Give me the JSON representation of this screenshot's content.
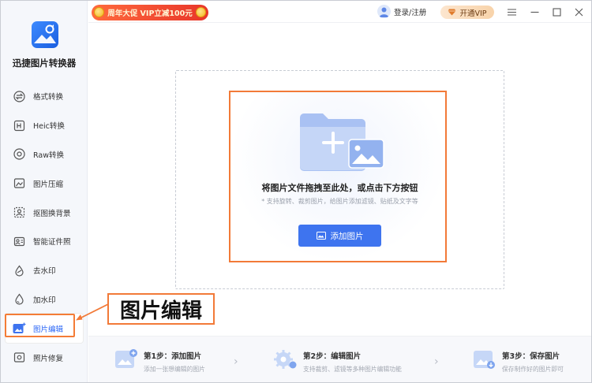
{
  "app": {
    "name": "迅捷图片转换器"
  },
  "titlebar": {
    "promo_text": "周年大促 VIP立减100元",
    "login_label": "登录/注册",
    "vip_label": "开通VIP",
    "menu_icon": "menu-icon",
    "minimize_icon": "minimize-icon",
    "maximize_icon": "maximize-icon",
    "close_icon": "close-icon"
  },
  "sidebar": {
    "items": [
      {
        "label": "格式转换",
        "icon": "format-convert-icon"
      },
      {
        "label": "Heic转换",
        "icon": "heic-icon"
      },
      {
        "label": "Raw转换",
        "icon": "raw-icon"
      },
      {
        "label": "图片压缩",
        "icon": "compress-icon"
      },
      {
        "label": "抠图换背景",
        "icon": "cutout-icon"
      },
      {
        "label": "智能证件照",
        "icon": "id-photo-icon"
      },
      {
        "label": "去水印",
        "icon": "remove-watermark-icon"
      },
      {
        "label": "加水印",
        "icon": "add-watermark-icon"
      },
      {
        "label": "图片编辑",
        "icon": "image-edit-icon",
        "active": true
      },
      {
        "label": "照片修复",
        "icon": "photo-repair-icon"
      }
    ]
  },
  "main": {
    "drop_title": "将图片文件拖拽至此处，或点击下方按钮",
    "drop_hint": "* 支持旋转、裁剪图片，给图片添加滤镜、贴纸及文字等",
    "add_button_label": "添加图片"
  },
  "steps": [
    {
      "title": "第1步：添加图片",
      "desc": "添加一张想编辑的图片"
    },
    {
      "title": "第2步：编辑图片",
      "desc": "支持裁剪、滤镜等多种图片编辑功能"
    },
    {
      "title": "第3步：保存图片",
      "desc": "保存制作好的图片即可"
    }
  ],
  "annotation": {
    "callout_text": "图片编辑"
  },
  "colors": {
    "accent": "#3e74ef",
    "highlight": "#f27a38",
    "promo": "#e8362a"
  }
}
